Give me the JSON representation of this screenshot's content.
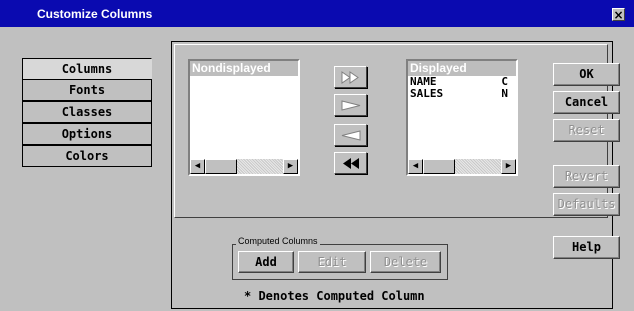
{
  "window": {
    "title": "Customize Columns",
    "close_glyph": "×"
  },
  "tabs": [
    {
      "label": "Columns",
      "active": true
    },
    {
      "label": "Fonts",
      "active": false
    },
    {
      "label": "Classes",
      "active": false
    },
    {
      "label": "Options",
      "active": false
    },
    {
      "label": "Colors",
      "active": false
    }
  ],
  "nondisplayed": {
    "header": "Nondisplayed",
    "items": []
  },
  "displayed": {
    "header": "Displayed",
    "items": [
      {
        "name": "NAME",
        "type": "C"
      },
      {
        "name": "SALES",
        "type": "N"
      }
    ]
  },
  "move_buttons": {
    "move_all_right_icon": "double-right-arrow-icon",
    "move_right_icon": "right-arrow-icon",
    "move_left_icon": "left-arrow-icon",
    "move_all_left_icon": "double-left-arrow-icon"
  },
  "computed_columns": {
    "group_label": "Computed Columns",
    "add": "Add",
    "edit": "Edit",
    "delete": "Delete"
  },
  "note": "* Denotes Computed Column",
  "right_buttons": {
    "ok": "OK",
    "cancel": "Cancel",
    "reset": "Reset",
    "revert": "Revert",
    "defaults": "Defaults",
    "help": "Help"
  }
}
